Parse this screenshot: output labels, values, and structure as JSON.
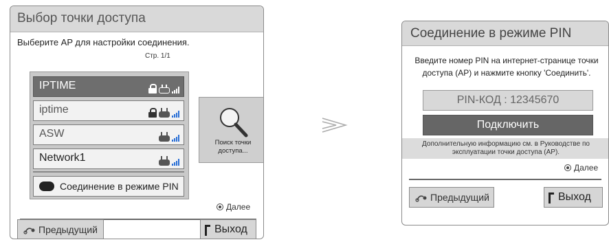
{
  "ap_dialog": {
    "title": "Выбор точки доступа",
    "instruction": "Выберите AP для настройки соединения.",
    "page": "Стр. 1/1",
    "access_points": [
      {
        "name": "IPTIME",
        "locked": true,
        "selected": true
      },
      {
        "name": "iptime",
        "locked": true,
        "selected": false
      },
      {
        "name": "ASW",
        "locked": false,
        "selected": false
      },
      {
        "name": "Network1",
        "locked": false,
        "selected": false
      }
    ],
    "pin_mode_label": "Соединение в режиме PIN",
    "search_label": "Поиск точки доступа...",
    "next_label": "Далее",
    "back_label": "Предыдущий",
    "exit_label": "Выход"
  },
  "pin_dialog": {
    "title": "Соединение в режиме PIN",
    "instruction": "Введите номер PIN на интернет-странице точки доступа (AP) и нажмите кнопку 'Соединить'.",
    "pin_code": "PIN-КОД : 12345670",
    "connect_label": "Подключить",
    "info": "Дополнительную информацию см. в Руководстве по эксплуатации точки доступа (AP).",
    "next_label": "Далее",
    "back_label": "Предыдущий",
    "exit_label": "Выход"
  },
  "icons": {
    "lock": "lock-icon",
    "router": "router-icon",
    "signal": "signal-bars-icon",
    "search": "search-icon",
    "back": "back-arrow-icon",
    "transition": "transition-arrow-icon"
  },
  "colors": {
    "title_bar": "#d9d9d9",
    "selected_item": "#6e6e6e",
    "signal": "#2a6fd6",
    "connect_button": "#666666"
  }
}
